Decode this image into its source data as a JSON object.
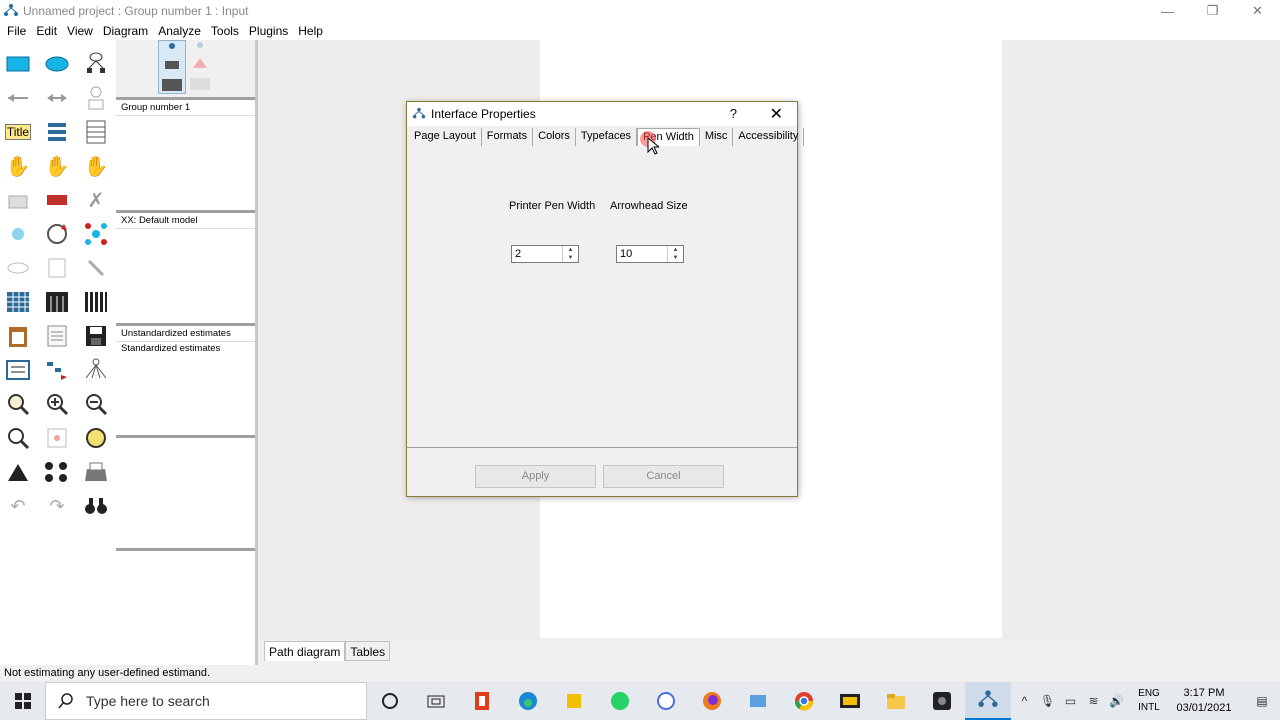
{
  "window": {
    "title": "Unnamed project : Group number 1 : Input",
    "minimize": "—",
    "maximize": "❐",
    "close": "✕"
  },
  "menu": [
    "File",
    "Edit",
    "View",
    "Diagram",
    "Analyze",
    "Tools",
    "Plugins",
    "Help"
  ],
  "toolbox": {
    "title_tool": "Title"
  },
  "panel": {
    "groups": "Group number 1",
    "models": "XX: Default model",
    "estimates": [
      "Unstandardized estimates",
      "Standardized estimates"
    ]
  },
  "dialog": {
    "title": "Interface Properties",
    "help": "?",
    "close": "✕",
    "tabs": [
      "Page Layout",
      "Formats",
      "Colors",
      "Typefaces",
      "Pen Width",
      "Misc",
      "Accessibility"
    ],
    "active_tab": "Pen Width",
    "printer_pen_width_label": "Printer Pen Width",
    "printer_pen_width_value": "2",
    "arrowhead_size_label": "Arrowhead Size",
    "arrowhead_size_value": "10",
    "apply": "Apply",
    "cancel": "Cancel"
  },
  "bottom_tabs": [
    "Path diagram",
    "Tables"
  ],
  "status": "Not estimating any user-defined estimand.",
  "taskbar": {
    "search_placeholder": "Type here to search",
    "lang1": "ENG",
    "lang2": "INTL",
    "time": "3:17 PM",
    "date": "03/01/2021"
  },
  "colors": {
    "accent": "#0078d7",
    "dialog_border": "#8a7a3a",
    "cursor": "#ff4646"
  }
}
